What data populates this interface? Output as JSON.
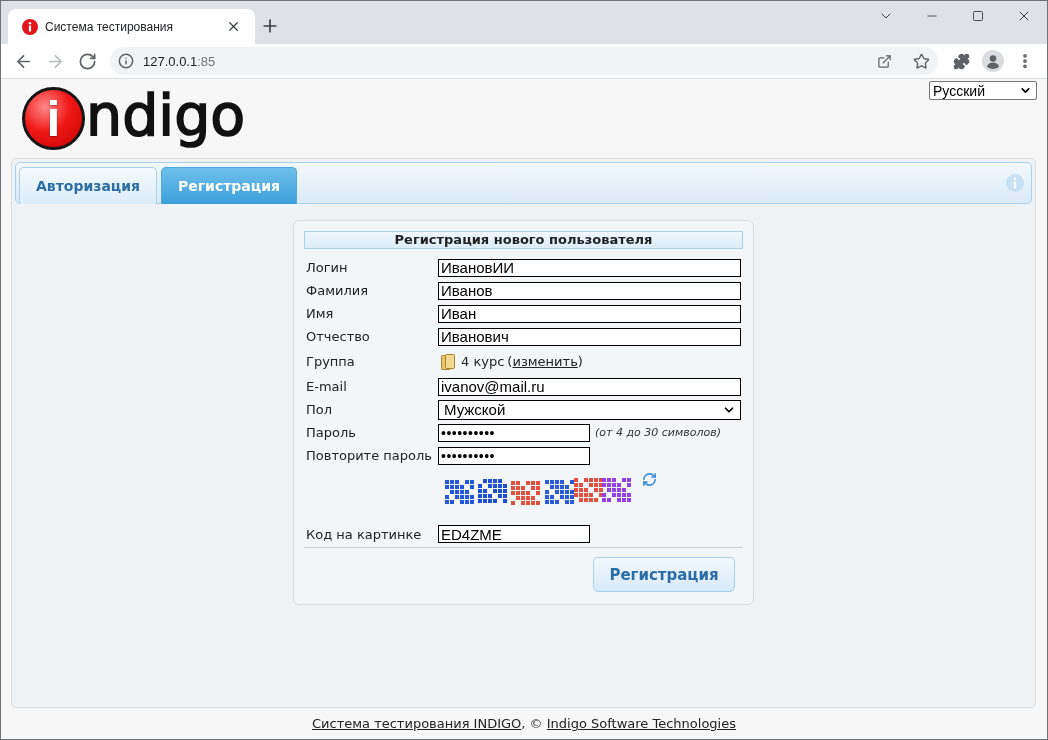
{
  "browser": {
    "tabs": [
      {
        "title": "Система тестирования",
        "selected": true
      }
    ],
    "nav": [
      {
        "kind": "back",
        "disabled": false
      },
      {
        "kind": "forward",
        "disabled": true
      },
      {
        "kind": "reload",
        "disabled": false
      }
    ],
    "url": {
      "host": "127.0.0.1",
      "port": ":85"
    }
  },
  "header": {
    "logo": {
      "mark": "i",
      "text": "ndigo"
    },
    "language": "Русский"
  },
  "tabs": [
    {
      "label": "Авторизация",
      "selected": false
    },
    {
      "label": "Регистрация",
      "selected": true
    }
  ],
  "form": {
    "title": "Регистрация нового пользователя",
    "fields": [
      {
        "kind": "text",
        "label": "Логин",
        "value": "ИвановИИ"
      },
      {
        "kind": "text",
        "label": "Фамилия",
        "value": "Иванов"
      },
      {
        "kind": "text",
        "label": "Имя",
        "value": "Иван"
      },
      {
        "kind": "text",
        "label": "Отчество",
        "value": "Иванович"
      },
      {
        "kind": "group",
        "label": "Группа",
        "value": "4 курс",
        "link": {
          "before": "(",
          "label": "изменить",
          "after": ")"
        }
      },
      {
        "kind": "text",
        "label": "E-mail",
        "value": "ivanov@mail.ru"
      },
      {
        "kind": "select",
        "label": "Пол",
        "value": "Мужской"
      },
      {
        "kind": "password",
        "label": "Пароль",
        "value": "••••••••••",
        "hint": "(от 4 до 30 символов)"
      },
      {
        "kind": "password",
        "label": "Повторите пароль",
        "value": "••••••••••"
      },
      {
        "kind": "captcha"
      },
      {
        "kind": "code",
        "label": "Код на картинке",
        "value": "ED4ZME"
      }
    ],
    "submit": "Регистрация"
  },
  "footer": {
    "parts": [
      {
        "kind": "link",
        "text": "Система тестирования INDIGO"
      },
      {
        "kind": "text",
        "text": ", © "
      },
      {
        "kind": "link",
        "text": "Indigo Software Technologies"
      }
    ]
  }
}
